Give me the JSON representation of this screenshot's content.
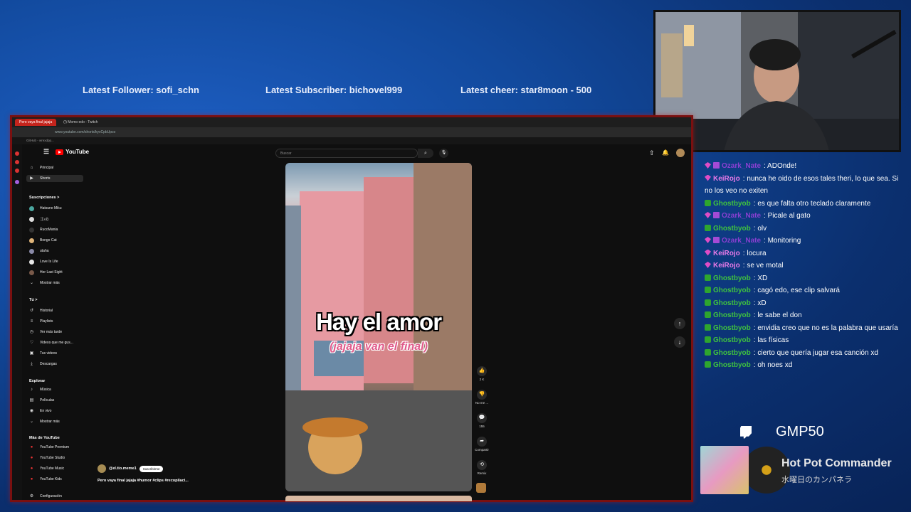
{
  "overlay": {
    "latest_follower": "Latest Follower: sofi_schn",
    "latest_subscriber": "Latest Subscriber: bichovel999",
    "latest_cheer": "Latest cheer: star8moon - 500"
  },
  "browser": {
    "tabs": [
      {
        "label": "Pero vaya final jajaja",
        "active": true
      },
      {
        "label": "(!) Momo edo - Twitch",
        "active": false
      }
    ],
    "url": "www.youtube.com/shorts/kyxCpbUpco",
    "bookmark": "GitHub - wrexdpp..."
  },
  "youtube": {
    "logo": "YouTube",
    "search_placeholder": "Buscar",
    "sidebar": {
      "main": [
        {
          "label": "Principal",
          "icon": "home-icon"
        },
        {
          "label": "Shorts",
          "icon": "shorts-icon"
        }
      ],
      "subscriptions_header": "Suscripciones  >",
      "subscriptions": [
        "Hatsune Miku",
        "ゴ♪の",
        "RucoMania",
        "Bongo Cat",
        "utaha",
        "Love Is Life",
        "Her Last Sight"
      ],
      "show_more": "Mostrar más",
      "you_header": "Tú  >",
      "you": [
        "Historial",
        "Playlists",
        "Ver más tarde",
        "Videos que me gus...",
        "Tus videos",
        "Descargas"
      ],
      "explore_header": "Explorar",
      "explore": [
        "Música",
        "Películas",
        "En vivo"
      ],
      "show_more2": "Mostrar más",
      "more_header": "Más de YouTube",
      "more": [
        "YouTube Premium",
        "YouTube Studio",
        "YouTube Music",
        "YouTube Kids"
      ],
      "settings": "Configuración"
    },
    "video": {
      "title_overlay": "Hay el amor",
      "subtitle_overlay": "(jajaja van el final)",
      "channel": "@el.tio.meme1",
      "subscribe": "Suscribirme",
      "description": "Pero vaya final jajaja #humor #clips #recopilaci..."
    },
    "actions": {
      "likes": "2 K",
      "dislike": "No me ...",
      "comments": "155",
      "share": "Compartir",
      "remix": "Remix"
    }
  },
  "chat": [
    {
      "user": "Ozark_Nate",
      "badge": "gem-sub",
      "color": "#8a3fd1",
      "text": "ADOnde!"
    },
    {
      "user": "KeiRojo",
      "badge": "gem",
      "color": "#e87ae8",
      "text": "nunca he oido de esos tales theri, lo que sea. Si no los veo no exiten"
    },
    {
      "user": "Ghostbyob",
      "badge": "check",
      "color": "#3fc23f",
      "text": "es que falta otro teclado claramente"
    },
    {
      "user": "Ozark_Nate",
      "badge": "gem-sub",
      "color": "#8a3fd1",
      "text": "Picale al gato"
    },
    {
      "user": "Ghostbyob",
      "badge": "check",
      "color": "#3fc23f",
      "text": "olv"
    },
    {
      "user": "Ozark_Nate",
      "badge": "gem-sub",
      "color": "#8a3fd1",
      "text": "Monitoring"
    },
    {
      "user": "KeiRojo",
      "badge": "gem",
      "color": "#e87ae8",
      "text": "locura"
    },
    {
      "user": "KeiRojo",
      "badge": "gem",
      "color": "#e87ae8",
      "text": "se ve motal"
    },
    {
      "user": "Ghostbyob",
      "badge": "check",
      "color": "#3fc23f",
      "text": "XD"
    },
    {
      "user": "Ghostbyob",
      "badge": "check",
      "color": "#3fc23f",
      "text": "cagó edo, ese clip salvará"
    },
    {
      "user": "Ghostbyob",
      "badge": "check",
      "color": "#3fc23f",
      "text": "xD"
    },
    {
      "user": "Ghostbyob",
      "badge": "check",
      "color": "#3fc23f",
      "text": "le sabe el don"
    },
    {
      "user": "Ghostbyob",
      "badge": "check",
      "color": "#3fc23f",
      "text": "envidia creo que no es la palabra que usaría"
    },
    {
      "user": "Ghostbyob",
      "badge": "check",
      "color": "#3fc23f",
      "text": "las físicas"
    },
    {
      "user": "Ghostbyob",
      "badge": "check",
      "color": "#3fc23f",
      "text": "cierto que quería jugar esa canción xd"
    },
    {
      "user": "Ghostbyob",
      "badge": "check",
      "color": "#3fc23f",
      "text": "oh noes xd"
    }
  ],
  "stream_code": "GMP50",
  "now_playing": {
    "title": "Hot Pot Commander",
    "artist": "水曜日のカンパネラ"
  }
}
